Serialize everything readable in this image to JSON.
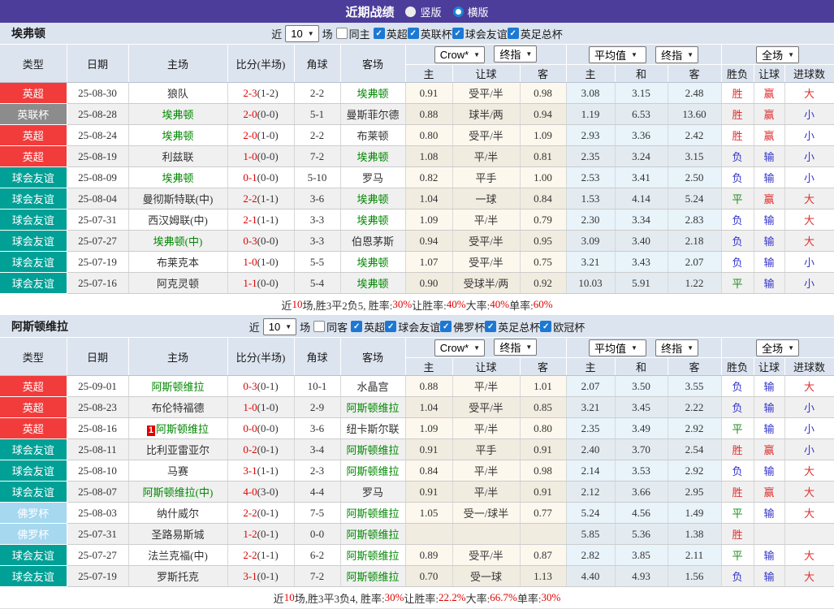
{
  "titlebar": {
    "title": "近期战绩",
    "radio_vertical": "竖版",
    "radio_horizontal": "横版"
  },
  "colors": {
    "titlebar_bg": "#4d3d9a",
    "panel_bg": "#dce4ef",
    "team_highlight": "#008800",
    "score_red": "#e00000",
    "result": {
      "r": "#e03030",
      "g": "#1e8c1e",
      "b": "#3434cc"
    },
    "type": {
      "英超": "#f23c3c",
      "英联杯": "#8c8c8c",
      "球会友谊": "#00a096",
      "佛罗杯": "#a6d8f0"
    },
    "checkbox_blue": "#1d78d4",
    "radio_ring_blue": "#1d83d4"
  },
  "table_header": {
    "type": "类型",
    "date": "日期",
    "home": "主场",
    "score": "比分(半场)",
    "corner": "角球",
    "away": "客场",
    "dd_company": "Crow*",
    "dd_final1": "终指",
    "dd_avg": "平均值",
    "dd_final2": "终指",
    "dd_scope": "全场",
    "odds_home": "主",
    "odds_handicap": "让球",
    "odds_away": "客",
    "avg_home": "主",
    "avg_draw": "和",
    "avg_away": "客",
    "res_wl": "胜负",
    "res_handicap": "让球",
    "res_goals": "进球数"
  },
  "sections": [
    {
      "team": "埃弗顿",
      "filter": {
        "near_label": "近",
        "count": "10",
        "games_label": "场",
        "same_label": "同主",
        "leagues": [
          "英超",
          "英联杯",
          "球会友谊",
          "英足总杯"
        ]
      },
      "rows": [
        {
          "type": "英超",
          "date": "25-08-30",
          "home": "狼队",
          "hg": false,
          "score": "2-3",
          "half": "(1-2)",
          "corner": "2-2",
          "away": "埃弗顿",
          "ag": true,
          "o1": "0.91",
          "hcp": "受平/半",
          "o2": "0.98",
          "a1": "3.08",
          "a2": "3.15",
          "a3": "2.48",
          "wl": "胜",
          "wlk": "r",
          "hr": "赢",
          "hrk": "r",
          "gl": "大",
          "glk": "r"
        },
        {
          "type": "英联杯",
          "date": "25-08-28",
          "home": "埃弗顿",
          "hg": true,
          "score": "2-0",
          "half": "(0-0)",
          "corner": "5-1",
          "away": "曼斯菲尔德",
          "ag": false,
          "o1": "0.88",
          "hcp": "球半/两",
          "o2": "0.94",
          "a1": "1.19",
          "a2": "6.53",
          "a3": "13.60",
          "wl": "胜",
          "wlk": "r",
          "hr": "赢",
          "hrk": "r",
          "gl": "小",
          "glk": "b"
        },
        {
          "type": "英超",
          "date": "25-08-24",
          "home": "埃弗顿",
          "hg": true,
          "score": "2-0",
          "half": "(1-0)",
          "corner": "2-2",
          "away": "布莱顿",
          "ag": false,
          "o1": "0.80",
          "hcp": "受平/半",
          "o2": "1.09",
          "a1": "2.93",
          "a2": "3.36",
          "a3": "2.42",
          "wl": "胜",
          "wlk": "r",
          "hr": "赢",
          "hrk": "r",
          "gl": "小",
          "glk": "b"
        },
        {
          "type": "英超",
          "date": "25-08-19",
          "home": "利兹联",
          "hg": false,
          "score": "1-0",
          "half": "(0-0)",
          "corner": "7-2",
          "away": "埃弗顿",
          "ag": true,
          "o1": "1.08",
          "hcp": "平/半",
          "o2": "0.81",
          "a1": "2.35",
          "a2": "3.24",
          "a3": "3.15",
          "wl": "负",
          "wlk": "b",
          "hr": "输",
          "hrk": "b",
          "gl": "小",
          "glk": "b"
        },
        {
          "type": "球会友谊",
          "date": "25-08-09",
          "home": "埃弗顿",
          "hg": true,
          "score": "0-1",
          "half": "(0-0)",
          "corner": "5-10",
          "away": "罗马",
          "ag": false,
          "o1": "0.82",
          "hcp": "平手",
          "o2": "1.00",
          "a1": "2.53",
          "a2": "3.41",
          "a3": "2.50",
          "wl": "负",
          "wlk": "b",
          "hr": "输",
          "hrk": "b",
          "gl": "小",
          "glk": "b"
        },
        {
          "type": "球会友谊",
          "date": "25-08-04",
          "home": "曼彻斯特联(中)",
          "hg": false,
          "score": "2-2",
          "half": "(1-1)",
          "corner": "3-6",
          "away": "埃弗顿",
          "ag": true,
          "o1": "1.04",
          "hcp": "一球",
          "o2": "0.84",
          "a1": "1.53",
          "a2": "4.14",
          "a3": "5.24",
          "wl": "平",
          "wlk": "g",
          "hr": "赢",
          "hrk": "r",
          "gl": "大",
          "glk": "r"
        },
        {
          "type": "球会友谊",
          "date": "25-07-31",
          "home": "西汉姆联(中)",
          "hg": false,
          "score": "2-1",
          "half": "(1-1)",
          "corner": "3-3",
          "away": "埃弗顿",
          "ag": true,
          "o1": "1.09",
          "hcp": "平/半",
          "o2": "0.79",
          "a1": "2.30",
          "a2": "3.34",
          "a3": "2.83",
          "wl": "负",
          "wlk": "b",
          "hr": "输",
          "hrk": "b",
          "gl": "大",
          "glk": "r"
        },
        {
          "type": "球会友谊",
          "date": "25-07-27",
          "home": "埃弗顿(中)",
          "hg": true,
          "score": "0-3",
          "half": "(0-0)",
          "corner": "3-3",
          "away": "伯恩茅斯",
          "ag": false,
          "o1": "0.94",
          "hcp": "受平/半",
          "o2": "0.95",
          "a1": "3.09",
          "a2": "3.40",
          "a3": "2.18",
          "wl": "负",
          "wlk": "b",
          "hr": "输",
          "hrk": "b",
          "gl": "大",
          "glk": "r"
        },
        {
          "type": "球会友谊",
          "date": "25-07-19",
          "home": "布莱克本",
          "hg": false,
          "score": "1-0",
          "half": "(1-0)",
          "corner": "5-5",
          "away": "埃弗顿",
          "ag": true,
          "o1": "1.07",
          "hcp": "受平/半",
          "o2": "0.75",
          "a1": "3.21",
          "a2": "3.43",
          "a3": "2.07",
          "wl": "负",
          "wlk": "b",
          "hr": "输",
          "hrk": "b",
          "gl": "小",
          "glk": "b"
        },
        {
          "type": "球会友谊",
          "date": "25-07-16",
          "home": "阿克灵顿",
          "hg": false,
          "score": "1-1",
          "half": "(0-0)",
          "corner": "5-4",
          "away": "埃弗顿",
          "ag": true,
          "o1": "0.90",
          "hcp": "受球半/两",
          "o2": "0.92",
          "a1": "10.03",
          "a2": "5.91",
          "a3": "1.22",
          "wl": "平",
          "wlk": "g",
          "hr": "输",
          "hrk": "b",
          "gl": "小",
          "glk": "b"
        }
      ],
      "summary": [
        {
          "t": "近"
        },
        {
          "t": "10",
          "r": true
        },
        {
          "t": "场,胜3平2负5, 胜率:"
        },
        {
          "t": "30%",
          "r": true
        },
        {
          "t": " 让胜率:"
        },
        {
          "t": "40%",
          "r": true
        },
        {
          "t": " 大率:"
        },
        {
          "t": "40%",
          "r": true
        },
        {
          "t": " 单率:"
        },
        {
          "t": "60%",
          "r": true
        }
      ]
    },
    {
      "team": "阿斯顿维拉",
      "filter": {
        "near_label": "近",
        "count": "10",
        "games_label": "场",
        "same_label": "同客",
        "leagues": [
          "英超",
          "球会友谊",
          "佛罗杯",
          "英足总杯",
          "欧冠杯"
        ]
      },
      "rows": [
        {
          "type": "英超",
          "date": "25-09-01",
          "home": "阿斯顿维拉",
          "hg": true,
          "score": "0-3",
          "half": "(0-1)",
          "corner": "10-1",
          "away": "水晶宫",
          "ag": false,
          "o1": "0.88",
          "hcp": "平/半",
          "o2": "1.01",
          "a1": "2.07",
          "a2": "3.50",
          "a3": "3.55",
          "wl": "负",
          "wlk": "b",
          "hr": "输",
          "hrk": "b",
          "gl": "大",
          "glk": "r"
        },
        {
          "type": "英超",
          "date": "25-08-23",
          "home": "布伦特福德",
          "hg": false,
          "score": "1-0",
          "half": "(1-0)",
          "corner": "2-9",
          "away": "阿斯顿维拉",
          "ag": true,
          "o1": "1.04",
          "hcp": "受平/半",
          "o2": "0.85",
          "a1": "3.21",
          "a2": "3.45",
          "a3": "2.22",
          "wl": "负",
          "wlk": "b",
          "hr": "输",
          "hrk": "b",
          "gl": "小",
          "glk": "b"
        },
        {
          "type": "英超",
          "date": "25-08-16",
          "badge": "1",
          "home": "阿斯顿维拉",
          "hg": true,
          "score": "0-0",
          "half": "(0-0)",
          "corner": "3-6",
          "away": "纽卡斯尔联",
          "ag": false,
          "o1": "1.09",
          "hcp": "平/半",
          "o2": "0.80",
          "a1": "2.35",
          "a2": "3.49",
          "a3": "2.92",
          "wl": "平",
          "wlk": "g",
          "hr": "输",
          "hrk": "b",
          "gl": "小",
          "glk": "b"
        },
        {
          "type": "球会友谊",
          "date": "25-08-11",
          "home": "比利亚雷亚尔",
          "hg": false,
          "score": "0-2",
          "half": "(0-1)",
          "corner": "3-4",
          "away": "阿斯顿维拉",
          "ag": true,
          "o1": "0.91",
          "hcp": "平手",
          "o2": "0.91",
          "a1": "2.40",
          "a2": "3.70",
          "a3": "2.54",
          "wl": "胜",
          "wlk": "r",
          "hr": "赢",
          "hrk": "r",
          "gl": "小",
          "glk": "b"
        },
        {
          "type": "球会友谊",
          "date": "25-08-10",
          "home": "马赛",
          "hg": false,
          "score": "3-1",
          "half": "(1-1)",
          "corner": "2-3",
          "away": "阿斯顿维拉",
          "ag": true,
          "o1": "0.84",
          "hcp": "平/半",
          "o2": "0.98",
          "a1": "2.14",
          "a2": "3.53",
          "a3": "2.92",
          "wl": "负",
          "wlk": "b",
          "hr": "输",
          "hrk": "b",
          "gl": "大",
          "glk": "r"
        },
        {
          "type": "球会友谊",
          "date": "25-08-07",
          "home": "阿斯顿维拉(中)",
          "hg": true,
          "score": "4-0",
          "half": "(3-0)",
          "corner": "4-4",
          "away": "罗马",
          "ag": false,
          "o1": "0.91",
          "hcp": "平/半",
          "o2": "0.91",
          "a1": "2.12",
          "a2": "3.66",
          "a3": "2.95",
          "wl": "胜",
          "wlk": "r",
          "hr": "赢",
          "hrk": "r",
          "gl": "大",
          "glk": "r"
        },
        {
          "type": "佛罗杯",
          "date": "25-08-03",
          "home": "纳什威尔",
          "hg": false,
          "score": "2-2",
          "half": "(0-1)",
          "corner": "7-5",
          "away": "阿斯顿维拉",
          "ag": true,
          "o1": "1.05",
          "hcp": "受一/球半",
          "o2": "0.77",
          "a1": "5.24",
          "a2": "4.56",
          "a3": "1.49",
          "wl": "平",
          "wlk": "g",
          "hr": "输",
          "hrk": "b",
          "gl": "大",
          "glk": "r"
        },
        {
          "type": "佛罗杯",
          "date": "25-07-31",
          "home": "圣路易斯城",
          "hg": false,
          "score": "1-2",
          "half": "(0-1)",
          "corner": "0-0",
          "away": "阿斯顿维拉",
          "ag": true,
          "o1": "",
          "hcp": "",
          "o2": "",
          "a1": "5.85",
          "a2": "5.36",
          "a3": "1.38",
          "wl": "胜",
          "wlk": "r",
          "hr": "",
          "hrk": "",
          "gl": "",
          "glk": ""
        },
        {
          "type": "球会友谊",
          "date": "25-07-27",
          "home": "法兰克福(中)",
          "hg": false,
          "score": "2-2",
          "half": "(1-1)",
          "corner": "6-2",
          "away": "阿斯顿维拉",
          "ag": true,
          "o1": "0.89",
          "hcp": "受平/半",
          "o2": "0.87",
          "a1": "2.82",
          "a2": "3.85",
          "a3": "2.11",
          "wl": "平",
          "wlk": "g",
          "hr": "输",
          "hrk": "b",
          "gl": "大",
          "glk": "r"
        },
        {
          "type": "球会友谊",
          "date": "25-07-19",
          "home": "罗斯托克",
          "hg": false,
          "score": "3-1",
          "half": "(0-1)",
          "corner": "7-2",
          "away": "阿斯顿维拉",
          "ag": true,
          "o1": "0.70",
          "hcp": "受一球",
          "o2": "1.13",
          "a1": "4.40",
          "a2": "4.93",
          "a3": "1.56",
          "wl": "负",
          "wlk": "b",
          "hr": "输",
          "hrk": "b",
          "gl": "大",
          "glk": "r"
        }
      ],
      "summary": [
        {
          "t": "近"
        },
        {
          "t": "10",
          "r": true
        },
        {
          "t": "场,胜3平3负4, 胜率:"
        },
        {
          "t": "30%",
          "r": true
        },
        {
          "t": " 让胜率:"
        },
        {
          "t": "22.2%",
          "r": true
        },
        {
          "t": " 大率:"
        },
        {
          "t": "66.7%",
          "r": true
        },
        {
          "t": " 单率:"
        },
        {
          "t": "30%",
          "r": true
        }
      ]
    }
  ]
}
